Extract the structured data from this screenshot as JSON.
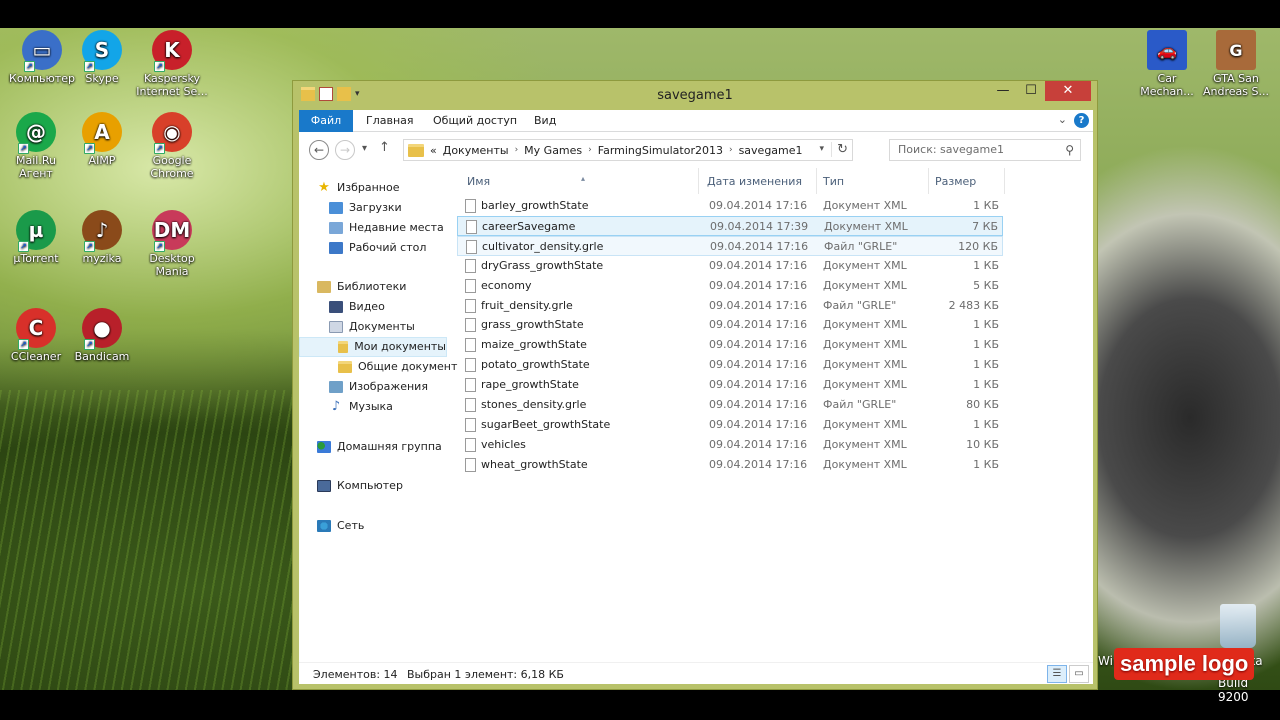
{
  "desktop": {
    "left_icons": [
      {
        "label": "Компьютер",
        "color": "#3a6fc8",
        "glyph": "▭"
      },
      {
        "label": "Skype",
        "color": "#12a5e8",
        "glyph": "S"
      },
      {
        "label": "Kaspersky Internet Se...",
        "color": "#c8202a",
        "glyph": "K"
      },
      {
        "label": "Mail.Ru Агент",
        "color": "#1aa84a",
        "glyph": "@"
      },
      {
        "label": "AIMP",
        "color": "#e8a000",
        "glyph": "A"
      },
      {
        "label": "Google Chrome",
        "color": "#d8402a",
        "glyph": "◉"
      },
      {
        "label": "µTorrent",
        "color": "#1a9a4a",
        "glyph": "µ"
      },
      {
        "label": "myzika",
        "color": "#8a4a1a",
        "glyph": "♪"
      },
      {
        "label": "Desktop Mania",
        "color": "#c83a5a",
        "glyph": "DM"
      },
      {
        "label": "CCleaner",
        "color": "#d8302a",
        "glyph": "C"
      },
      {
        "label": "Bandicam",
        "color": "#b8202a",
        "glyph": "●"
      }
    ],
    "right_icons": [
      {
        "label": "Car Mechan...",
        "color": "#2a5ac8",
        "glyph": "🚗"
      },
      {
        "label": "GTA San Andreas S...",
        "color": "#a86a3a",
        "glyph": "G"
      }
    ],
    "windows_text": "Win",
    "windows_text_suffix": "ka",
    "build_text": "Build 9200",
    "logo_text": "sample logo"
  },
  "window": {
    "title": "savegame1",
    "controls": {
      "minimize": "—",
      "maximize": "☐",
      "close": "✕"
    },
    "ribbon_tabs": [
      "Файл",
      "Главная",
      "Общий доступ",
      "Вид"
    ],
    "help": "?",
    "address": {
      "prefix": "«",
      "crumbs": [
        "Документы",
        "My Games",
        "FarmingSimulator2013",
        "savegame1"
      ]
    },
    "search_placeholder": "Поиск: savegame1"
  },
  "nav": {
    "favorites": "Избранное",
    "downloads": "Загрузки",
    "recent": "Недавние места",
    "desktop": "Рабочий стол",
    "libraries": "Библиотеки",
    "video": "Видео",
    "documents": "Документы",
    "my_documents": "Мои документы",
    "public_documents": "Общие документ",
    "images": "Изображения",
    "music": "Музыка",
    "homegroup": "Домашняя группа",
    "computer": "Компьютер",
    "network": "Сеть"
  },
  "columns": {
    "name": "Имя",
    "date": "Дата изменения",
    "type": "Тип",
    "size": "Размер"
  },
  "files": [
    {
      "name": "barley_growthState",
      "date": "09.04.2014 17:16",
      "type": "Документ XML",
      "size": "1 КБ"
    },
    {
      "name": "careerSavegame",
      "date": "09.04.2014 17:39",
      "type": "Документ XML",
      "size": "7 КБ"
    },
    {
      "name": "cultivator_density.grle",
      "date": "09.04.2014 17:16",
      "type": "Файл \"GRLE\"",
      "size": "120 КБ"
    },
    {
      "name": "dryGrass_growthState",
      "date": "09.04.2014 17:16",
      "type": "Документ XML",
      "size": "1 КБ"
    },
    {
      "name": "economy",
      "date": "09.04.2014 17:16",
      "type": "Документ XML",
      "size": "5 КБ"
    },
    {
      "name": "fruit_density.grle",
      "date": "09.04.2014 17:16",
      "type": "Файл \"GRLE\"",
      "size": "2 483 КБ"
    },
    {
      "name": "grass_growthState",
      "date": "09.04.2014 17:16",
      "type": "Документ XML",
      "size": "1 КБ"
    },
    {
      "name": "maize_growthState",
      "date": "09.04.2014 17:16",
      "type": "Документ XML",
      "size": "1 КБ"
    },
    {
      "name": "potato_growthState",
      "date": "09.04.2014 17:16",
      "type": "Документ XML",
      "size": "1 КБ"
    },
    {
      "name": "rape_growthState",
      "date": "09.04.2014 17:16",
      "type": "Документ XML",
      "size": "1 КБ"
    },
    {
      "name": "stones_density.grle",
      "date": "09.04.2014 17:16",
      "type": "Файл \"GRLE\"",
      "size": "80 КБ"
    },
    {
      "name": "sugarBeet_growthState",
      "date": "09.04.2014 17:16",
      "type": "Документ XML",
      "size": "1 КБ"
    },
    {
      "name": "vehicles",
      "date": "09.04.2014 17:16",
      "type": "Документ XML",
      "size": "10 КБ"
    },
    {
      "name": "wheat_growthState",
      "date": "09.04.2014 17:16",
      "type": "Документ XML",
      "size": "1 КБ"
    }
  ],
  "status": {
    "count": "Элементов: 14",
    "selected": "Выбран 1 элемент: 6,18 КБ"
  },
  "colors": {
    "accent": "#1979ca",
    "window_frame": "#b8c26a",
    "close": "#c7403a"
  }
}
